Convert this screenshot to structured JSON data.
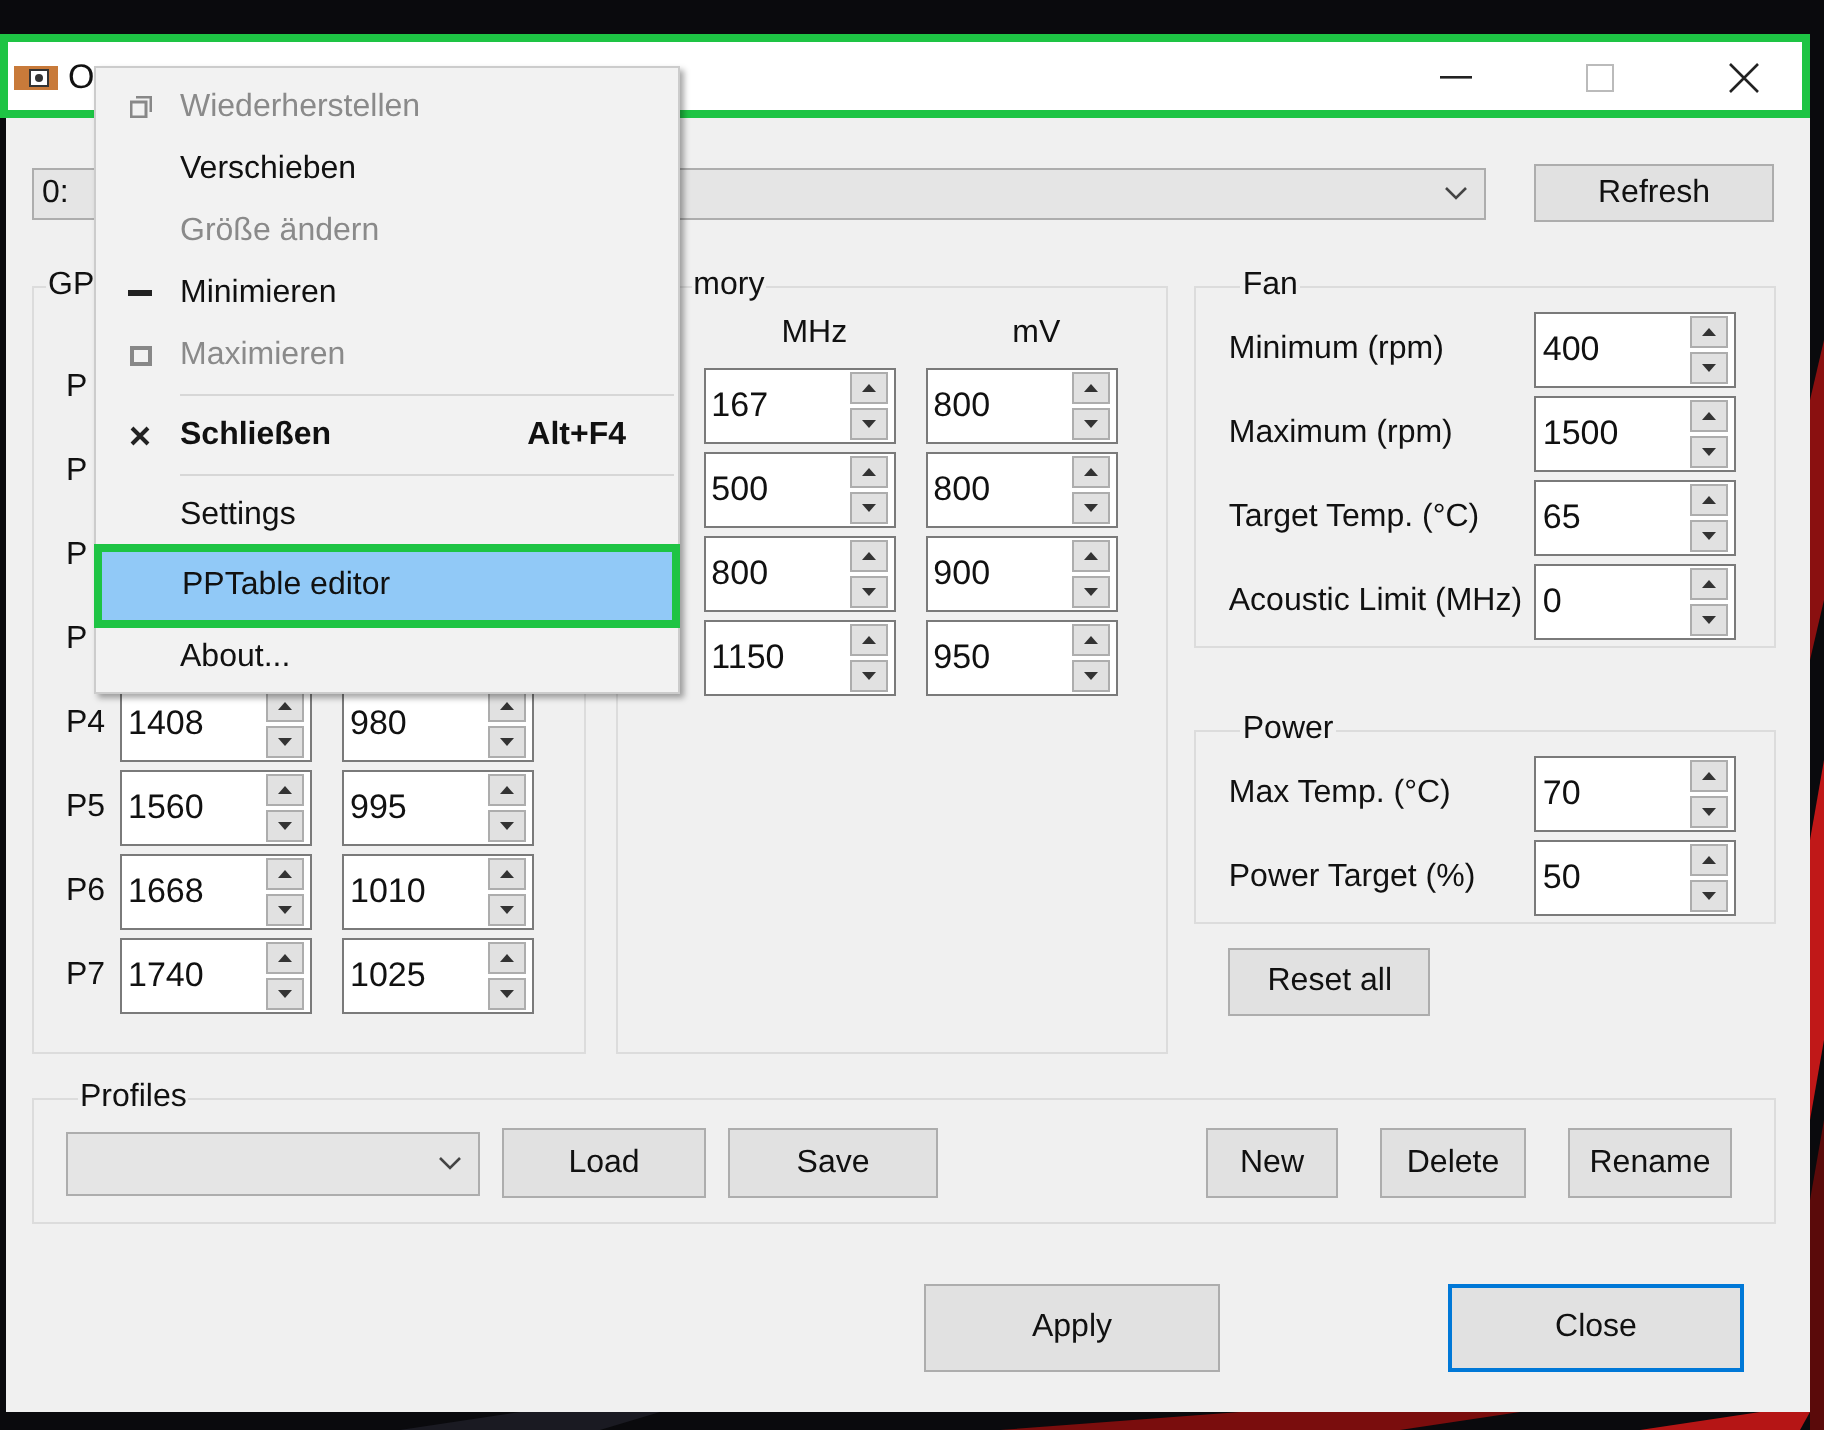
{
  "window": {
    "title": "O"
  },
  "gpu_select": {
    "value": "0:"
  },
  "refresh_button": "Refresh",
  "gpu_group": {
    "title": "GP",
    "rows": [
      {
        "label": "P"
      },
      {
        "label": "P"
      },
      {
        "label": "P"
      },
      {
        "label": "P"
      },
      {
        "label": "P4",
        "mhz": "1408",
        "mv": "980"
      },
      {
        "label": "P5",
        "mhz": "1560",
        "mv": "995"
      },
      {
        "label": "P6",
        "mhz": "1668",
        "mv": "1010"
      },
      {
        "label": "P7",
        "mhz": "1740",
        "mv": "1025"
      }
    ]
  },
  "memory_group": {
    "title": "mory",
    "columns": [
      "MHz",
      "mV"
    ],
    "rows": [
      {
        "mhz": "167",
        "mv": "800"
      },
      {
        "mhz": "500",
        "mv": "800"
      },
      {
        "mhz": "800",
        "mv": "900"
      },
      {
        "mhz": "1150",
        "mv": "950"
      }
    ]
  },
  "fan_group": {
    "title": "Fan",
    "fields": [
      {
        "label": "Minimum (rpm)",
        "value": "400"
      },
      {
        "label": "Maximum (rpm)",
        "value": "1500"
      },
      {
        "label": "Target Temp. (°C)",
        "value": "65"
      },
      {
        "label": "Acoustic Limit (MHz)",
        "value": "0"
      }
    ]
  },
  "power_group": {
    "title": "Power",
    "fields": [
      {
        "label": "Max Temp. (°C)",
        "value": "70"
      },
      {
        "label": "Power Target (%)",
        "value": "50"
      }
    ]
  },
  "reset_button": "Reset all",
  "profiles": {
    "title": "Profiles",
    "left_buttons": [
      "Load",
      "Save"
    ],
    "right_buttons": [
      "New",
      "Delete",
      "Rename"
    ]
  },
  "dialog_buttons": [
    {
      "label": "Apply",
      "focused": false
    },
    {
      "label": "Close",
      "focused": true
    }
  ],
  "menu": {
    "items": [
      {
        "kind": "restore",
        "label": "Wiederherstellen",
        "disabled": true,
        "selected": false
      },
      {
        "kind": "plain",
        "label": "Verschieben",
        "disabled": false,
        "selected": false
      },
      {
        "kind": "plain",
        "label": "Größe ändern",
        "disabled": true,
        "selected": false
      },
      {
        "kind": "minimize",
        "label": "Minimieren",
        "disabled": false,
        "selected": false
      },
      {
        "kind": "maximize",
        "label": "Maximieren",
        "disabled": true,
        "selected": false
      },
      {
        "kind": "separator"
      },
      {
        "kind": "close",
        "label": "Schließen",
        "shortcut": "Alt+F4",
        "disabled": false,
        "selected": false
      },
      {
        "kind": "separator"
      },
      {
        "kind": "plain",
        "label": "Settings",
        "disabled": false,
        "selected": false
      },
      {
        "kind": "plain",
        "label": "PPTable editor",
        "disabled": false,
        "selected": true
      },
      {
        "kind": "plain",
        "label": "About...",
        "disabled": false,
        "selected": false
      }
    ]
  }
}
